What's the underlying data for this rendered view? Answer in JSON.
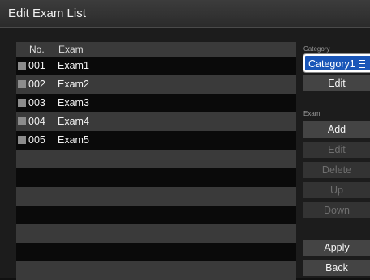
{
  "window": {
    "title": "Edit Exam List"
  },
  "list": {
    "columns": {
      "no": "No.",
      "exam": "Exam"
    },
    "rows": [
      {
        "no": "001",
        "name": "Exam1"
      },
      {
        "no": "002",
        "name": "Exam2"
      },
      {
        "no": "003",
        "name": "Exam3"
      },
      {
        "no": "004",
        "name": "Exam4"
      },
      {
        "no": "005",
        "name": "Exam5"
      }
    ]
  },
  "category": {
    "label": "Category",
    "selected": "Category1",
    "edit_label": "Edit"
  },
  "exam_actions": {
    "label": "Exam",
    "add": "Add",
    "edit": "Edit",
    "delete": "Delete",
    "up": "Up",
    "down": "Down"
  },
  "footer": {
    "apply": "Apply",
    "back": "Back"
  },
  "colors": {
    "accent": "#1a56b8",
    "row_alt": "#3a3a3a",
    "button": "#444444"
  }
}
